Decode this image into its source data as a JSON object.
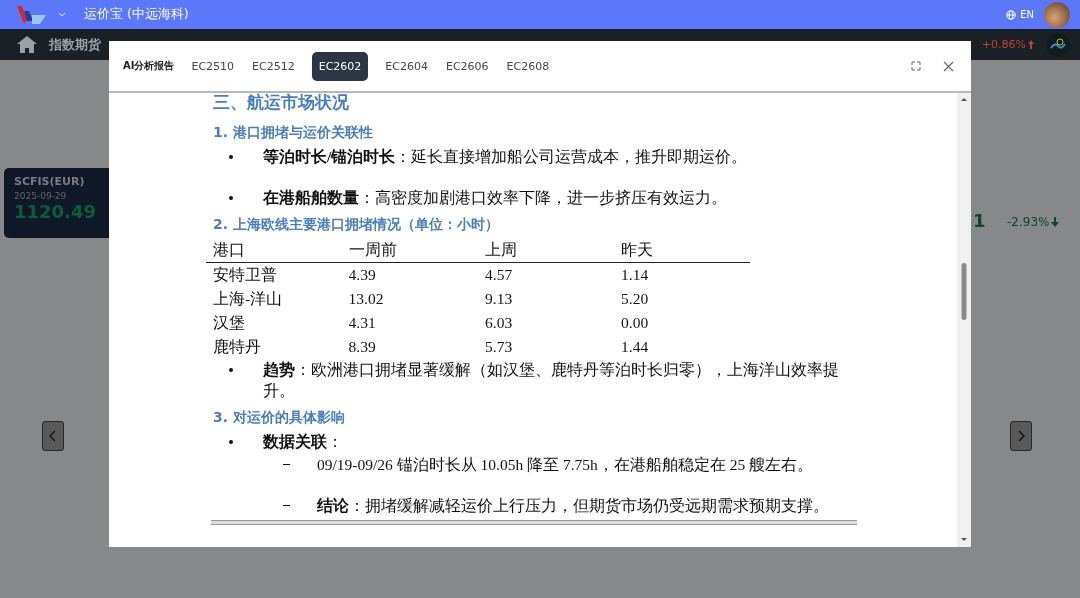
{
  "app": {
    "title": "运价宝 (中远海科)",
    "language": "EN"
  },
  "ticker": {
    "section": "指数期货",
    "change": "+0.86%"
  },
  "left_card": {
    "name": "SCFIS(EUR)",
    "date": "2025-09-29",
    "value": "1120.49"
  },
  "right_card": {
    "value": "1",
    "change": "-2.93%"
  },
  "modal": {
    "label": "AI分析报告",
    "tabs": [
      {
        "label": "EC2510",
        "selected": false
      },
      {
        "label": "EC2512",
        "selected": false
      },
      {
        "label": "EC2602",
        "selected": true
      },
      {
        "label": "EC2604",
        "selected": false
      },
      {
        "label": "EC2606",
        "selected": false
      },
      {
        "label": "EC2608",
        "selected": false
      }
    ],
    "document": {
      "heading": "三、航运市场状况",
      "sections": [
        {
          "heading": "1. 港口拥堵与运价关联性",
          "bullets": [
            {
              "text": "**等泊时长/锚泊时长**：延长直接增加船公司运营成本，推升即期运价。"
            },
            {
              "text": "**在港船舶数量**：高密度加剧港口效率下降，进一步挤压有效运力。"
            }
          ]
        },
        {
          "heading": "2. 上海欧线主要港口拥堵情况（单位：小时）",
          "table": {
            "columns": [
              "港口",
              "一周前",
              "上周",
              "昨天"
            ],
            "rows": [
              [
                "安特卫普",
                "4.39",
                "4.57",
                "1.14"
              ],
              [
                "上海-洋山",
                "13.02",
                "9.13",
                "5.20"
              ],
              [
                "汉堡",
                "4.31",
                "6.03",
                "0.00"
              ],
              [
                "鹿特丹",
                "8.39",
                "5.73",
                "1.44"
              ]
            ]
          },
          "bullets": [
            {
              "text": "**趋势**：欧洲港口拥堵显著缓解（如汉堡、鹿特丹等泊时长归零），上海洋山效率提升。"
            }
          ]
        },
        {
          "heading": "3. 对运价的具体影响",
          "bullets": [
            {
              "text": "**数据关联**：",
              "children": [
                {
                  "text": "09/19-09/26 锚泊时长从 10.05h 降至 7.75h，在港船舶稳定在 25 艘左右。"
                },
                {
                  "text": "**结论**：拥堵缓解减轻运价上行压力，但期货市场仍受远期需求预期支撑。"
                }
              ]
            }
          ]
        }
      ]
    }
  }
}
